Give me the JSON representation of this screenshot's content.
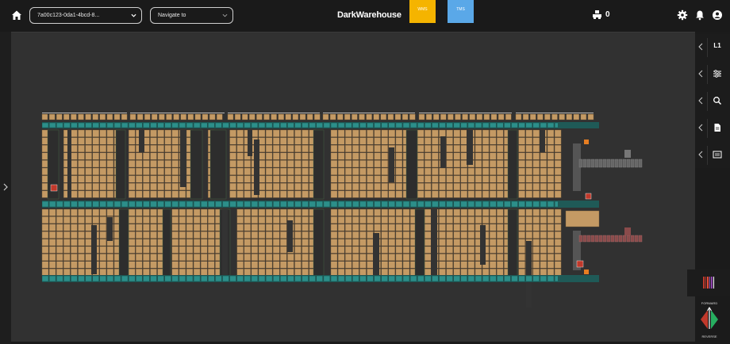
{
  "topbar": {
    "home_icon": "home-icon",
    "device_select": {
      "value": "7a00c123-0da1-4bcd-8..."
    },
    "navigate_select": {
      "value": "Navigate to"
    },
    "brand": "DarkWarehouse",
    "tabs": [
      {
        "label": "WMS",
        "color": "#f5b400"
      },
      {
        "label": "TMS",
        "color": "#5aa8e8"
      }
    ],
    "robot_count": "0",
    "icons": [
      "robot-icon",
      "gear-icon",
      "bell-icon",
      "account-icon"
    ]
  },
  "right_panel": {
    "items": [
      {
        "label": "L1",
        "icon": "level-indicator"
      },
      {
        "label": "",
        "icon": "sliders-icon"
      },
      {
        "label": "",
        "icon": "search-icon"
      },
      {
        "label": "",
        "icon": "document-icon"
      },
      {
        "label": "",
        "icon": "panel-icon"
      }
    ]
  },
  "direction": {
    "forward": "FORWARD",
    "reverse": "REVERSE"
  },
  "colors": {
    "cell": "#c49a64",
    "aisle": "#333333",
    "rail": "#2c8f8a",
    "accent_red": "#c0392b",
    "accent_green": "#27ae60"
  }
}
